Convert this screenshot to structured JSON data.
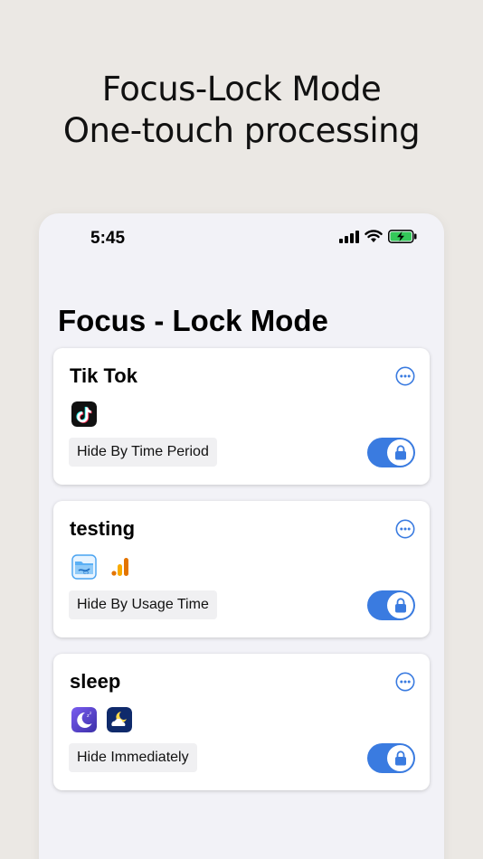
{
  "headline": {
    "line1": "Focus-Lock Mode",
    "line2": "One-touch processing"
  },
  "status_bar": {
    "time": "5:45"
  },
  "page_title": "Focus - Lock Mode",
  "colors": {
    "accent": "#3a7be0",
    "toggle_on": "#3a7be0",
    "battery": "#34c759"
  },
  "cards": [
    {
      "title": "Tik Tok",
      "mode": "Hide By Time Period",
      "apps": [
        "tiktok-icon"
      ],
      "toggle_on": true
    },
    {
      "title": "testing",
      "mode": "Hide By Usage Time",
      "apps": [
        "file-transfer-app-icon",
        "analytics-app-icon"
      ],
      "toggle_on": true
    },
    {
      "title": "sleep",
      "mode": "Hide Immediately",
      "apps": [
        "sleep-moon-app-icon",
        "night-weather-app-icon"
      ],
      "toggle_on": true
    }
  ]
}
